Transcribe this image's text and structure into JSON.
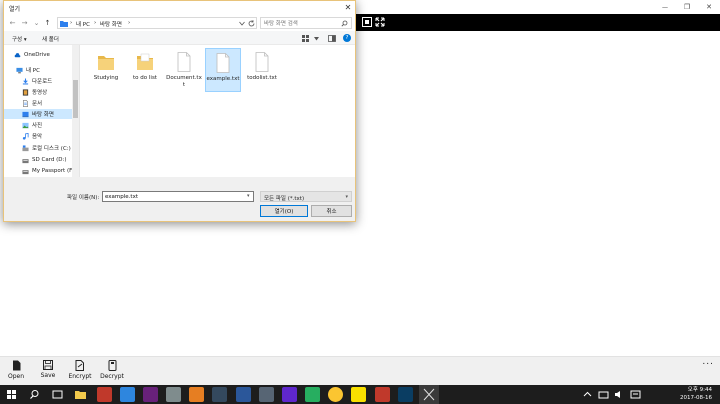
{
  "app": {
    "window_controls": {
      "minimize": "—",
      "maximize": "❐",
      "close": "✕"
    },
    "toolbar": [
      {
        "label": "Open",
        "icon": "open-file-icon"
      },
      {
        "label": "Save",
        "icon": "save-icon"
      },
      {
        "label": "Encrypt",
        "icon": "encrypt-icon"
      },
      {
        "label": "Decrypt",
        "icon": "decrypt-icon"
      }
    ],
    "more": "..."
  },
  "dialog": {
    "title": "열기",
    "close": "✕",
    "nav": {
      "back": "←",
      "forward": "→",
      "recent": "⌄",
      "up": "↑"
    },
    "breadcrumb": [
      "내 PC",
      "바탕 화면"
    ],
    "crumb_sep": "›",
    "search_placeholder": "바탕 화면 검색",
    "commands": {
      "organize": "구성 ▾",
      "new_folder": "새 폴더",
      "help": "?"
    },
    "tree": [
      {
        "label": "OneDrive",
        "icon": "cloud-icon"
      },
      {
        "label": "내 PC",
        "icon": "computer-icon"
      },
      {
        "label": "다운로드",
        "icon": "download-icon"
      },
      {
        "label": "동영상",
        "icon": "video-icon"
      },
      {
        "label": "문서",
        "icon": "document-icon"
      },
      {
        "label": "바탕 화면",
        "icon": "desktop-icon",
        "selected": true
      },
      {
        "label": "사진",
        "icon": "picture-icon"
      },
      {
        "label": "음악",
        "icon": "music-icon"
      },
      {
        "label": "로컬 디스크 (C:)",
        "icon": "drive-icon"
      },
      {
        "label": "SD Card (D:)",
        "icon": "sd-card-icon"
      },
      {
        "label": "My Passport (F:)",
        "icon": "external-drive-icon"
      }
    ],
    "files": [
      {
        "name": "Studying",
        "type": "folder"
      },
      {
        "name": "to do list",
        "type": "folder"
      },
      {
        "name": "Document.txt",
        "type": "file"
      },
      {
        "name": "example.txt",
        "type": "file",
        "selected": true
      },
      {
        "name": "todolist.txt",
        "type": "file"
      }
    ],
    "filename_label": "파일 이름(N):",
    "filename_value": "example.txt",
    "filetype": "모든 파일 (*.txt)",
    "open_label": "열기(O)",
    "cancel_label": "취소"
  },
  "taskbar": {
    "time": "오후 9:44",
    "date": "2017-08-16",
    "colors": {
      "bar": "#1d1d1d",
      "accent": "#0078d7"
    }
  }
}
